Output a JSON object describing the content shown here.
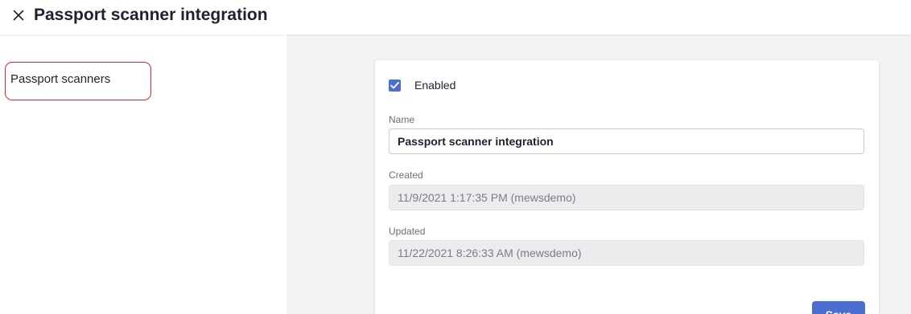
{
  "header": {
    "title": "Passport scanner integration",
    "close_icon": "close-icon"
  },
  "sidebar": {
    "items": [
      {
        "label": "Passport scanners",
        "highlight_color": "#e0272d"
      }
    ]
  },
  "form": {
    "enabled": {
      "label": "Enabled",
      "checked": true
    },
    "name": {
      "label": "Name",
      "value": "Passport scanner integration"
    },
    "created": {
      "label": "Created",
      "value": "11/9/2021 1:17:35 PM (mewsdemo)"
    },
    "updated": {
      "label": "Updated",
      "value": "11/22/2021 8:26:33 AM (mewsdemo)"
    },
    "save_label": "Save"
  },
  "colors": {
    "accent": "#4a6fd0",
    "background": "#f2f2f3",
    "highlight": "#e0272d"
  }
}
